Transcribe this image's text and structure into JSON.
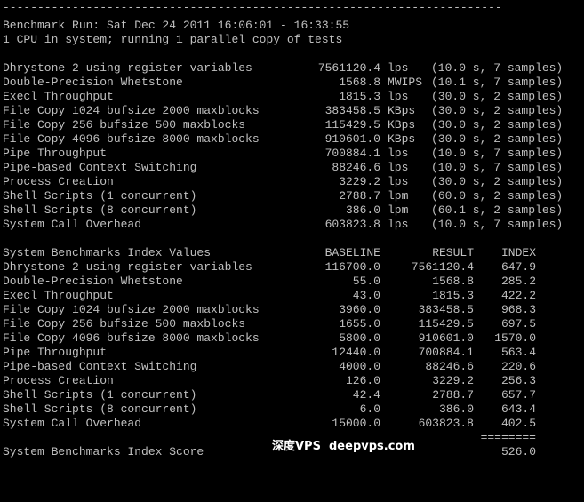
{
  "terminal": {
    "separator": "------------------------------------------------------------------------",
    "run_header": "Benchmark Run: Sat Dec 24 2011 16:06:01 - 16:33:55",
    "cpu_info": "1 CPU in system; running 1 parallel copy of tests",
    "results": [
      {
        "name": "Dhrystone 2 using register variables",
        "value": "7561120.4",
        "unit": "lps",
        "detail": "(10.0 s, 7 samples)"
      },
      {
        "name": "Double-Precision Whetstone",
        "value": "1568.8",
        "unit": "MWIPS",
        "detail": "(10.1 s, 7 samples)"
      },
      {
        "name": "Execl Throughput",
        "value": "1815.3",
        "unit": "lps",
        "detail": "(30.0 s, 2 samples)"
      },
      {
        "name": "File Copy 1024 bufsize 2000 maxblocks",
        "value": "383458.5",
        "unit": "KBps",
        "detail": "(30.0 s, 2 samples)"
      },
      {
        "name": "File Copy 256 bufsize 500 maxblocks",
        "value": "115429.5",
        "unit": "KBps",
        "detail": "(30.0 s, 2 samples)"
      },
      {
        "name": "File Copy 4096 bufsize 8000 maxblocks",
        "value": "910601.0",
        "unit": "KBps",
        "detail": "(30.0 s, 2 samples)"
      },
      {
        "name": "Pipe Throughput",
        "value": "700884.1",
        "unit": "lps",
        "detail": "(10.0 s, 7 samples)"
      },
      {
        "name": "Pipe-based Context Switching",
        "value": "88246.6",
        "unit": "lps",
        "detail": "(10.0 s, 7 samples)"
      },
      {
        "name": "Process Creation",
        "value": "3229.2",
        "unit": "lps",
        "detail": "(30.0 s, 2 samples)"
      },
      {
        "name": "Shell Scripts (1 concurrent)",
        "value": "2788.7",
        "unit": "lpm",
        "detail": "(60.0 s, 2 samples)"
      },
      {
        "name": "Shell Scripts (8 concurrent)",
        "value": "386.0",
        "unit": "lpm",
        "detail": "(60.1 s, 2 samples)"
      },
      {
        "name": "System Call Overhead",
        "value": "603823.8",
        "unit": "lps",
        "detail": "(10.0 s, 7 samples)"
      }
    ],
    "index_header": {
      "title": "System Benchmarks Index Values",
      "baseline": "BASELINE",
      "result": "RESULT",
      "index": "INDEX"
    },
    "index_rows": [
      {
        "name": "Dhrystone 2 using register variables",
        "baseline": "116700.0",
        "result": "7561120.4",
        "index": "647.9"
      },
      {
        "name": "Double-Precision Whetstone",
        "baseline": "55.0",
        "result": "1568.8",
        "index": "285.2"
      },
      {
        "name": "Execl Throughput",
        "baseline": "43.0",
        "result": "1815.3",
        "index": "422.2"
      },
      {
        "name": "File Copy 1024 bufsize 2000 maxblocks",
        "baseline": "3960.0",
        "result": "383458.5",
        "index": "968.3"
      },
      {
        "name": "File Copy 256 bufsize 500 maxblocks",
        "baseline": "1655.0",
        "result": "115429.5",
        "index": "697.5"
      },
      {
        "name": "File Copy 4096 bufsize 8000 maxblocks",
        "baseline": "5800.0",
        "result": "910601.0",
        "index": "1570.0"
      },
      {
        "name": "Pipe Throughput",
        "baseline": "12440.0",
        "result": "700884.1",
        "index": "563.4"
      },
      {
        "name": "Pipe-based Context Switching",
        "baseline": "4000.0",
        "result": "88246.6",
        "index": "220.6"
      },
      {
        "name": "Process Creation",
        "baseline": "126.0",
        "result": "3229.2",
        "index": "256.3"
      },
      {
        "name": "Shell Scripts (1 concurrent)",
        "baseline": "42.4",
        "result": "2788.7",
        "index": "657.7"
      },
      {
        "name": "Shell Scripts (8 concurrent)",
        "baseline": "6.0",
        "result": "386.0",
        "index": "643.4"
      },
      {
        "name": "System Call Overhead",
        "baseline": "15000.0",
        "result": "603823.8",
        "index": "402.5"
      }
    ],
    "score_rule": "========",
    "score_label": "System Benchmarks Index Score",
    "score_value": "526.0",
    "watermark": "深度VPS  deepvps.com"
  },
  "colors": {
    "background": "#000000",
    "text": "#c0c0c0",
    "watermark": "#ffffff"
  }
}
